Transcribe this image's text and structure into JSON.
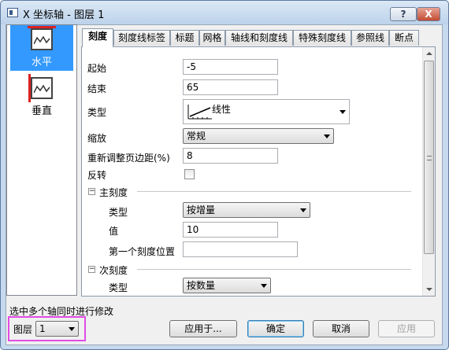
{
  "window": {
    "title": "X 坐标轴 - 图层 1",
    "help_label": "?",
    "close_label": "X"
  },
  "sidebar": {
    "items": [
      {
        "label": "水平",
        "selected": true
      },
      {
        "label": "垂直",
        "selected": false
      }
    ]
  },
  "tabs": [
    {
      "label": "刻度",
      "active": true
    },
    {
      "label": "刻度线标签"
    },
    {
      "label": "标题"
    },
    {
      "label": "网格"
    },
    {
      "label": "轴线和刻度线"
    },
    {
      "label": "特殊刻度线"
    },
    {
      "label": "参照线"
    },
    {
      "label": "断点"
    }
  ],
  "form": {
    "start_label": "起始",
    "start_value": "-5",
    "end_label": "结束",
    "end_value": "65",
    "type_label": "类型",
    "type_value": "线性",
    "type_icon": "linear-scale-icon",
    "zoom_label": "缩放",
    "zoom_value": "常规",
    "margin_label": "重新调整页边距(%)",
    "margin_value": "8",
    "reverse_label": "反转",
    "reverse_checked": false,
    "major": {
      "header": "主刻度",
      "toggle": "−",
      "type_label": "类型",
      "type_value": "按增量",
      "value_label": "值",
      "value_value": "10",
      "first_tick_label": "第一个刻度位置",
      "first_tick_value": ""
    },
    "minor": {
      "header": "次刻度",
      "toggle": "−",
      "type_label": "类型",
      "type_value": "按数量"
    }
  },
  "footer": {
    "multi_axis_text": "选中多个轴同时进行修改",
    "layer_label": "图层",
    "layer_value": "1",
    "apply_to_label": "应用于...",
    "ok_label": "确定",
    "cancel_label": "取消",
    "apply_label": "应用"
  },
  "colors": {
    "selection": "#3399ff",
    "highlight_box": "#e14be3",
    "title_bar": "#c6d9ee",
    "close_button": "#c24c33"
  }
}
